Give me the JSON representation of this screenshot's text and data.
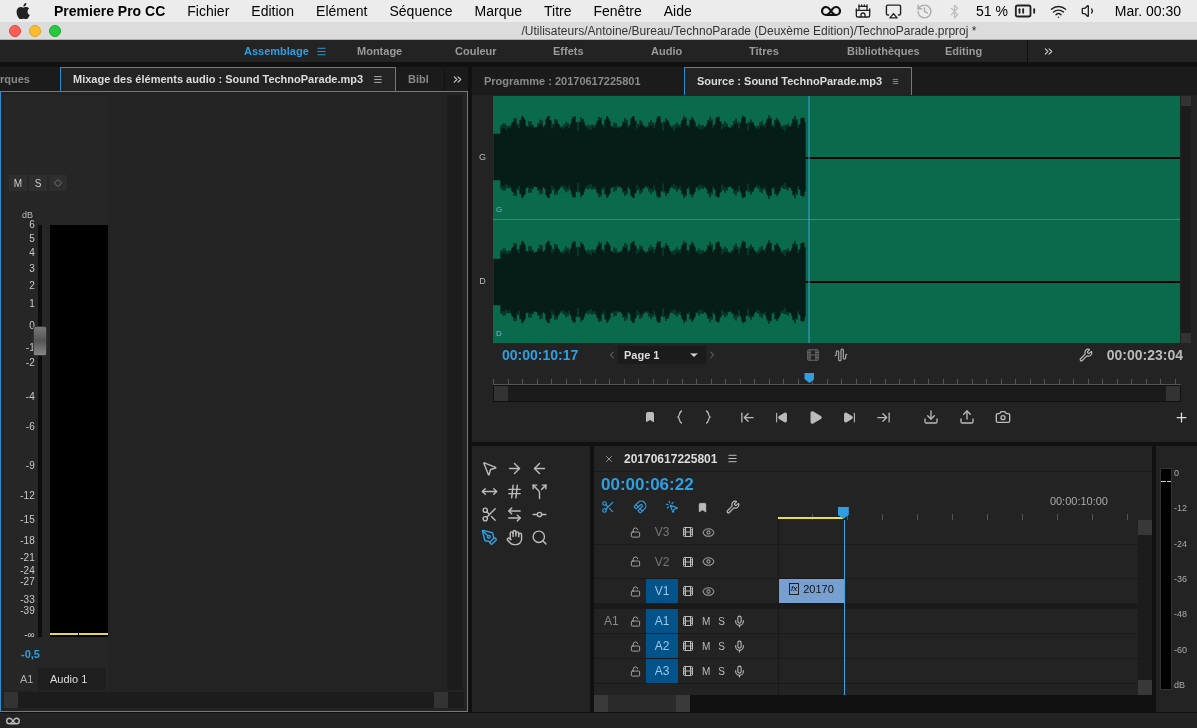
{
  "menubar": {
    "app": "Premiere Pro CC",
    "menus": [
      "Fichier",
      "Edition",
      "Elément",
      "Séquence",
      "Marque",
      "Titre",
      "Fenêtre",
      "Aide"
    ],
    "battery": "51 %",
    "clock": "Mar. 00:30"
  },
  "window": {
    "title": "/Utilisateurs/Antoine/Bureau/TechnoParade (Deuxème Edition)/TechnoParade.prproj *"
  },
  "workspaces": [
    {
      "label": "Assemblage",
      "selected": true
    },
    {
      "label": "Montage",
      "selected": false
    },
    {
      "label": "Couleur",
      "selected": false
    },
    {
      "label": "Effets",
      "selected": false
    },
    {
      "label": "Audio",
      "selected": false
    },
    {
      "label": "Titres",
      "selected": false
    },
    {
      "label": "Bibliothèques",
      "selected": false
    },
    {
      "label": "Editing",
      "selected": false
    }
  ],
  "left_panel": {
    "tabs": [
      {
        "label": "rques",
        "selected": false
      },
      {
        "label": "Mixage des éléments audio : Sound TechnoParade.mp3",
        "selected": true
      },
      {
        "label": "Bibl",
        "selected": false
      }
    ]
  },
  "mixer": {
    "buttons": [
      "M",
      "S"
    ],
    "db_label": "dB",
    "scale": [
      "6",
      "5",
      "4",
      "3",
      "2",
      "1",
      "0",
      "-1",
      "-2",
      "-4",
      "-6",
      "-9",
      "-12",
      "-15",
      "-18",
      "-21",
      "-24",
      "-27",
      "-33",
      "-39",
      "-∞"
    ],
    "fader": {
      "level": 0.73
    },
    "readout": "-0,5",
    "track_id": "A1",
    "track_name": "Audio 1"
  },
  "monitor": {
    "tabs": [
      {
        "label": "Programme : 20170617225801",
        "selected": false
      },
      {
        "label": "Source : Sound TechnoParade.mp3",
        "selected": true
      }
    ],
    "channels": [
      {
        "label": "G",
        "inner_label": "G"
      },
      {
        "label": "D",
        "inner_label": "D"
      }
    ],
    "timecode": "00:00:10:17",
    "page": "Page 1",
    "duration": "00:00:23:04",
    "playhead": {
      "level": 0.46
    }
  },
  "timeline": {
    "title": "20170617225801",
    "timecode": "00:00:06:22",
    "ruler_label": "00:00:10:00",
    "playhead": {
      "level": 0.18
    },
    "video_tracks": [
      {
        "name": "V3",
        "targeted": false
      },
      {
        "name": "V2",
        "targeted": false
      },
      {
        "name": "V1",
        "targeted": true
      }
    ],
    "audio_tracks": [
      {
        "source": "A1",
        "name": "A1",
        "targeted": true,
        "mute": "M",
        "solo": "S"
      },
      {
        "name": "A2",
        "targeted": true,
        "mute": "M",
        "solo": "S"
      },
      {
        "name": "A3",
        "targeted": true,
        "mute": "M",
        "solo": "S"
      }
    ],
    "clip": {
      "badge": "fx",
      "label": "20170"
    }
  },
  "meter": {
    "scale": [
      "0",
      "-12",
      "-24",
      "-36",
      "-48",
      "-60"
    ],
    "unit": "dB"
  }
}
